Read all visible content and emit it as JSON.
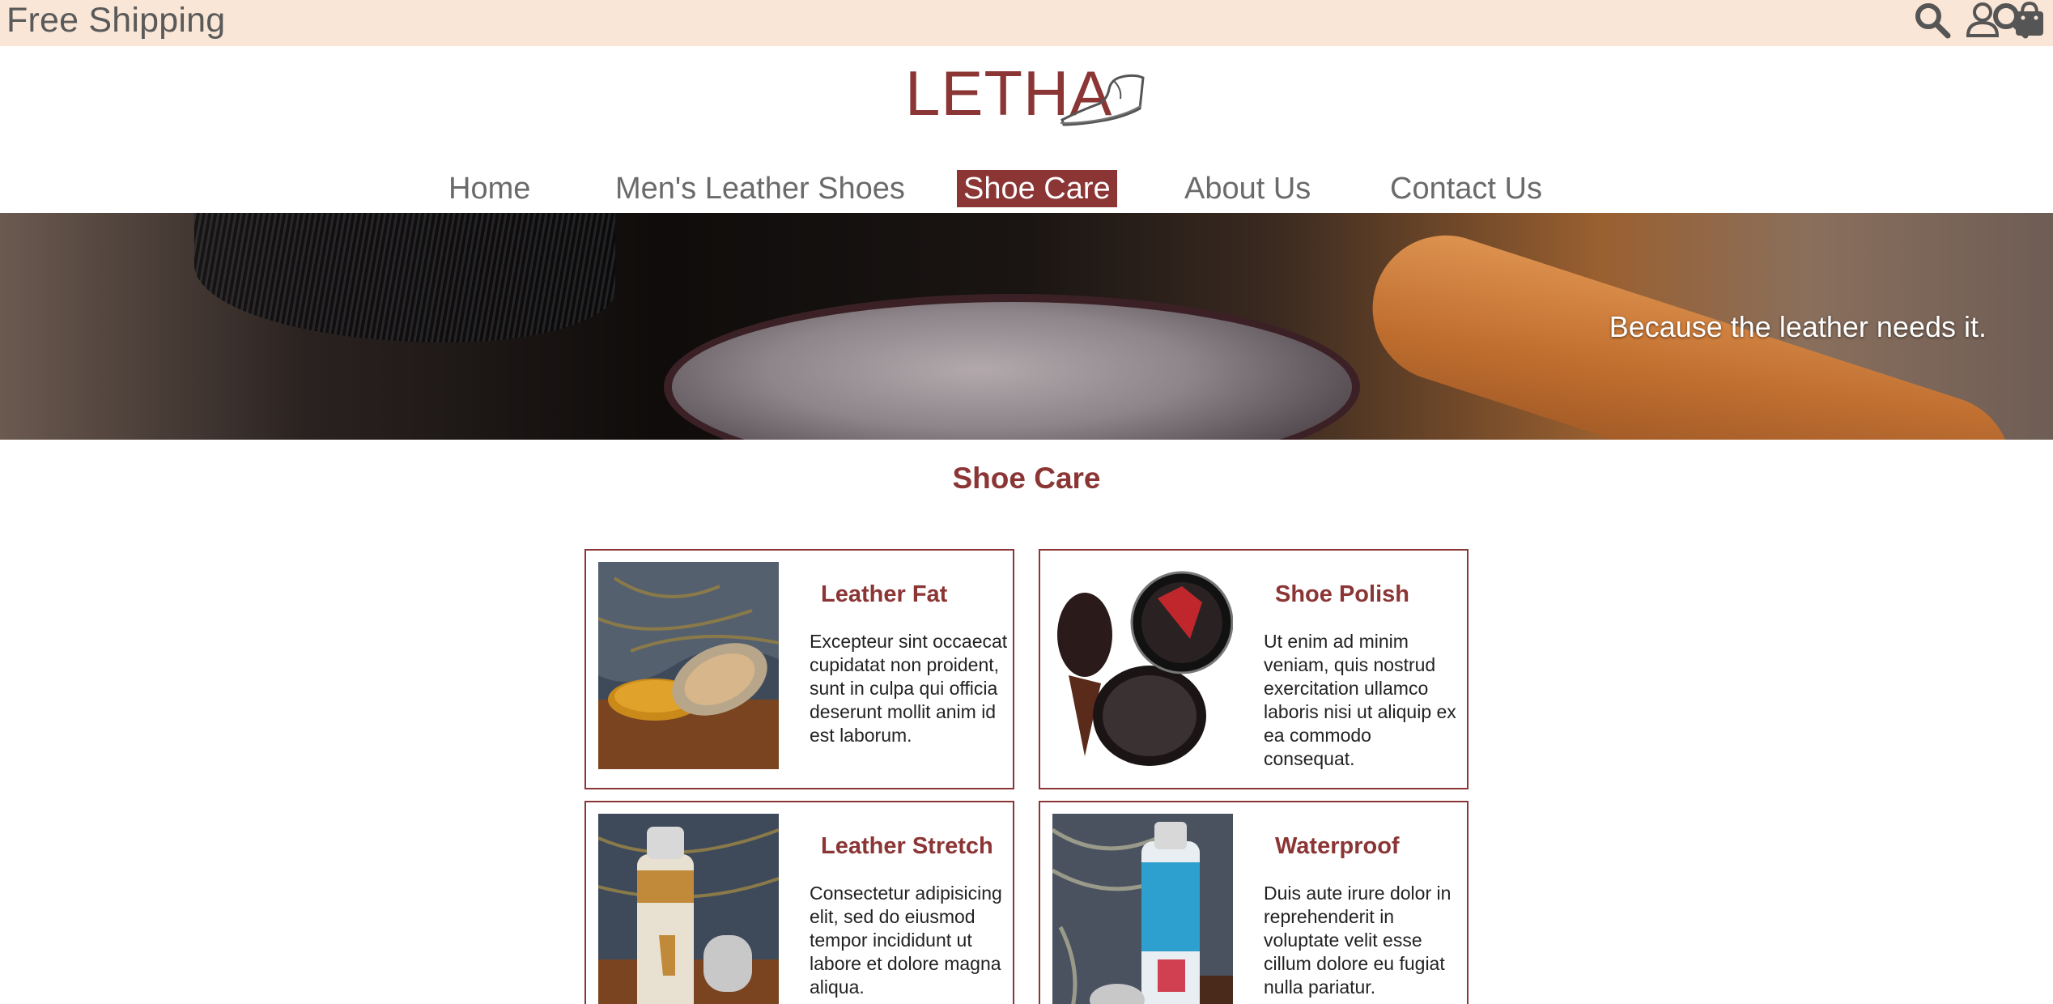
{
  "topbar": {
    "promo": "Free Shipping",
    "icons": [
      "search-icon",
      "user-icon",
      "shopping-bag-icon"
    ]
  },
  "logo": {
    "text": "LETHA",
    "mark": "shoe-logo-icon"
  },
  "nav": {
    "items": [
      {
        "label": "Home",
        "active": false
      },
      {
        "label": "Men's Leather Shoes",
        "active": false
      },
      {
        "label": "Shoe Care",
        "active": true
      },
      {
        "label": "About Us",
        "active": false
      },
      {
        "label": "Contact Us",
        "active": false
      }
    ]
  },
  "hero": {
    "tagline": "Because the leather needs it."
  },
  "section": {
    "title": "Shoe Care"
  },
  "products": [
    {
      "title": "Leather Fat",
      "description": "Excepteur sint occaecat cupidatat non proident, sunt in culpa qui officia deserunt mollit anim id est laborum."
    },
    {
      "title": "Shoe Polish",
      "description": "Ut enim ad minim veniam, quis nostrud exercitation ullamco laboris nisi ut aliquip ex ea commodo consequat."
    },
    {
      "title": "Leather Stretch",
      "description": "Consectetur adipisicing elit, sed do eiusmod tempor incididunt ut labore et dolore magna aliqua."
    },
    {
      "title": "Waterproof",
      "description": "Duis aute irure dolor in reprehenderit in voluptate velit esse cillum dolore eu fugiat nulla pariatur."
    }
  ],
  "colors": {
    "brand": "#8b3535",
    "topbar_bg": "#fae6d6",
    "text": "#555555"
  }
}
